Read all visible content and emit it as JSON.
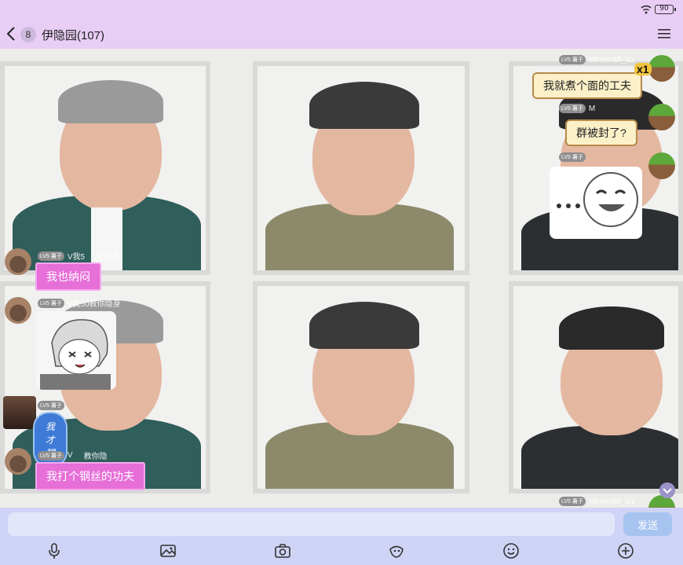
{
  "status": {
    "battery": "90"
  },
  "header": {
    "unread": "8",
    "title": "伊隐园(107)"
  },
  "wallpaper": {
    "description_icon": "portrait-wall"
  },
  "messages": [
    {
      "side": "right",
      "level": "LV5 薯子",
      "nick": "Minecraft_lzz",
      "text": "我就煮个面的工夫",
      "badge": "x1"
    },
    {
      "side": "right",
      "level": "LV5 薯子",
      "nick": "M",
      "text": "群被封了?"
    },
    {
      "side": "right",
      "level": "LV5 薯子",
      "nick": "",
      "sticker": "smiling-face-sticker"
    },
    {
      "side": "left",
      "level": "LV5 薯子",
      "nick": "V我5",
      "nick2": "你隐身",
      "text": "我也纳闷"
    },
    {
      "side": "left",
      "level": "LV5 薯子",
      "nick": "V我50教你隐身",
      "sticker": "anime-girl-sticker"
    },
    {
      "side": "left",
      "level": "LV5 薯子",
      "nick": "",
      "cloud_text": "我才醒"
    },
    {
      "side": "left",
      "level": "LV5 薯子",
      "nick": "V",
      "nick2": "教你隐",
      "text": "我打个钢丝的功夫"
    },
    {
      "side": "right",
      "level": "LV5 薯子",
      "nick": "Minecraft_lzz"
    }
  ],
  "input": {
    "placeholder": "",
    "send_label": "发送"
  },
  "colors": {
    "header": "#e8cdf4",
    "pink_bubble": "#e66fd8",
    "input_bar": "#cfd3f5",
    "send": "#a7c4f0"
  }
}
